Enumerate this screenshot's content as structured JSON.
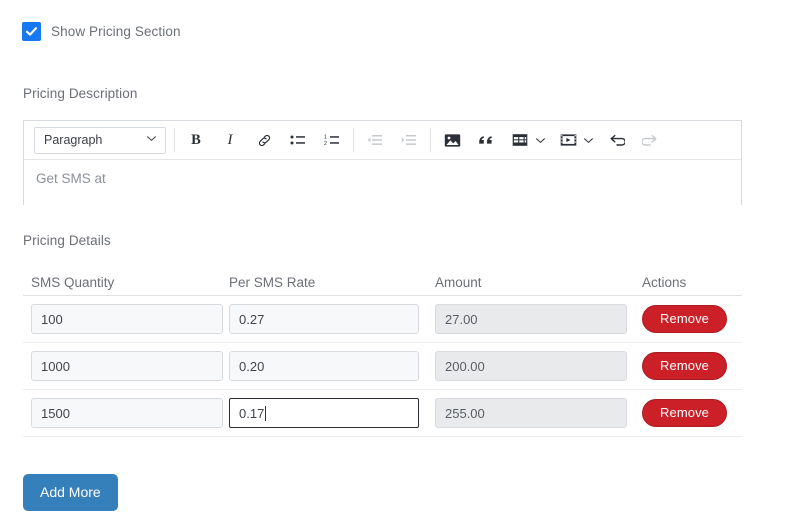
{
  "checkbox": {
    "label": "Show Pricing Section",
    "checked": true,
    "accent": "#1877f2"
  },
  "labels": {
    "pricing_description": "Pricing Description",
    "pricing_details": "Pricing Details"
  },
  "editor": {
    "block_format": "Paragraph",
    "content": "Get SMS at",
    "toolbar": [
      {
        "name": "bold-icon",
        "label": "B",
        "state": "enabled"
      },
      {
        "name": "italic-icon",
        "label": "I",
        "state": "enabled"
      },
      {
        "name": "link-icon",
        "label": "Link",
        "state": "enabled"
      },
      {
        "name": "bulleted-list-icon",
        "label": "Bulleted list",
        "state": "enabled"
      },
      {
        "name": "numbered-list-icon",
        "label": "Numbered list",
        "state": "enabled"
      },
      {
        "name": "outdent-icon",
        "label": "Decrease indent",
        "state": "disabled"
      },
      {
        "name": "indent-icon",
        "label": "Increase indent",
        "state": "disabled"
      },
      {
        "name": "image-icon",
        "label": "Insert image",
        "state": "enabled"
      },
      {
        "name": "blockquote-icon",
        "label": "Block quote",
        "state": "enabled"
      },
      {
        "name": "table-icon",
        "label": "Insert table",
        "state": "enabled"
      },
      {
        "name": "media-icon",
        "label": "Insert media",
        "state": "enabled"
      },
      {
        "name": "undo-icon",
        "label": "Undo",
        "state": "enabled"
      },
      {
        "name": "redo-icon",
        "label": "Redo",
        "state": "disabled"
      }
    ]
  },
  "table": {
    "headers": [
      "SMS Quantity",
      "Per SMS Rate",
      "Amount",
      "Actions"
    ],
    "remove_label": "Remove",
    "remove_color": "#cb2027",
    "rows": [
      {
        "quantity": "100",
        "rate": "0.27",
        "amount": "27.00",
        "focused_field": null
      },
      {
        "quantity": "1000",
        "rate": "0.20",
        "amount": "200.00",
        "focused_field": null
      },
      {
        "quantity": "1500",
        "rate": "0.17",
        "amount": "255.00",
        "focused_field": "rate"
      }
    ]
  },
  "add_more": {
    "label": "Add More",
    "color": "#3580ba"
  }
}
